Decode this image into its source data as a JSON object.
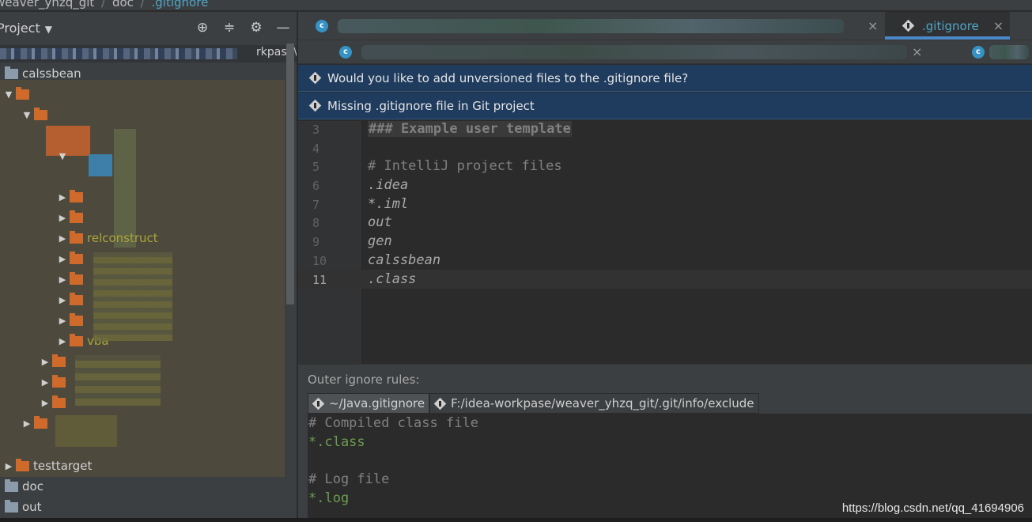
{
  "breadcrumb": {
    "project": "weaver_yhzq_git",
    "folder": "doc",
    "file": ".gitignore"
  },
  "project_pane": {
    "title": "Project",
    "path_suffix": "rkpase\\",
    "tools": [
      "locate-icon",
      "collapse-icon",
      "gear-icon",
      "minimize-icon"
    ],
    "tree": {
      "root": "calssbean",
      "visible_folders": [
        "relconstruct",
        "vba",
        "testtarget"
      ],
      "top_level": [
        "doc",
        "out"
      ]
    }
  },
  "editor": {
    "tabs_row1": {
      "active_tab": ".gitignore"
    },
    "notices": [
      "Would you like to add unversioned files to the .gitignore file?",
      "Missing .gitignore file in Git project"
    ],
    "lines": [
      {
        "no": "3",
        "text": "### Example user template"
      },
      {
        "no": "4",
        "text": ""
      },
      {
        "no": "5",
        "text": "# IntelliJ project files"
      },
      {
        "no": "6",
        "text": ".idea"
      },
      {
        "no": "7",
        "text": "*.iml"
      },
      {
        "no": "8",
        "text": "out"
      },
      {
        "no": "9",
        "text": "gen"
      },
      {
        "no": "10",
        "text": "calssbean"
      },
      {
        "no": "11",
        "text": ".class"
      }
    ]
  },
  "outer_rules": {
    "title": "Outer ignore rules:",
    "tabs": [
      "~/Java.gitignore",
      "F:/idea-workpase/weaver_yhzq_git/.git/info/exclude"
    ],
    "lines": [
      "# Compiled class file",
      "*.class",
      "",
      "# Log file",
      "*.log"
    ]
  },
  "watermark": "https://blog.csdn.net/qq_41694906",
  "colors": {
    "accent": "#4ea6c8",
    "notice_bg": "#1f3c5e",
    "folder": "#d06a2b",
    "green": "#6a9e4f"
  }
}
